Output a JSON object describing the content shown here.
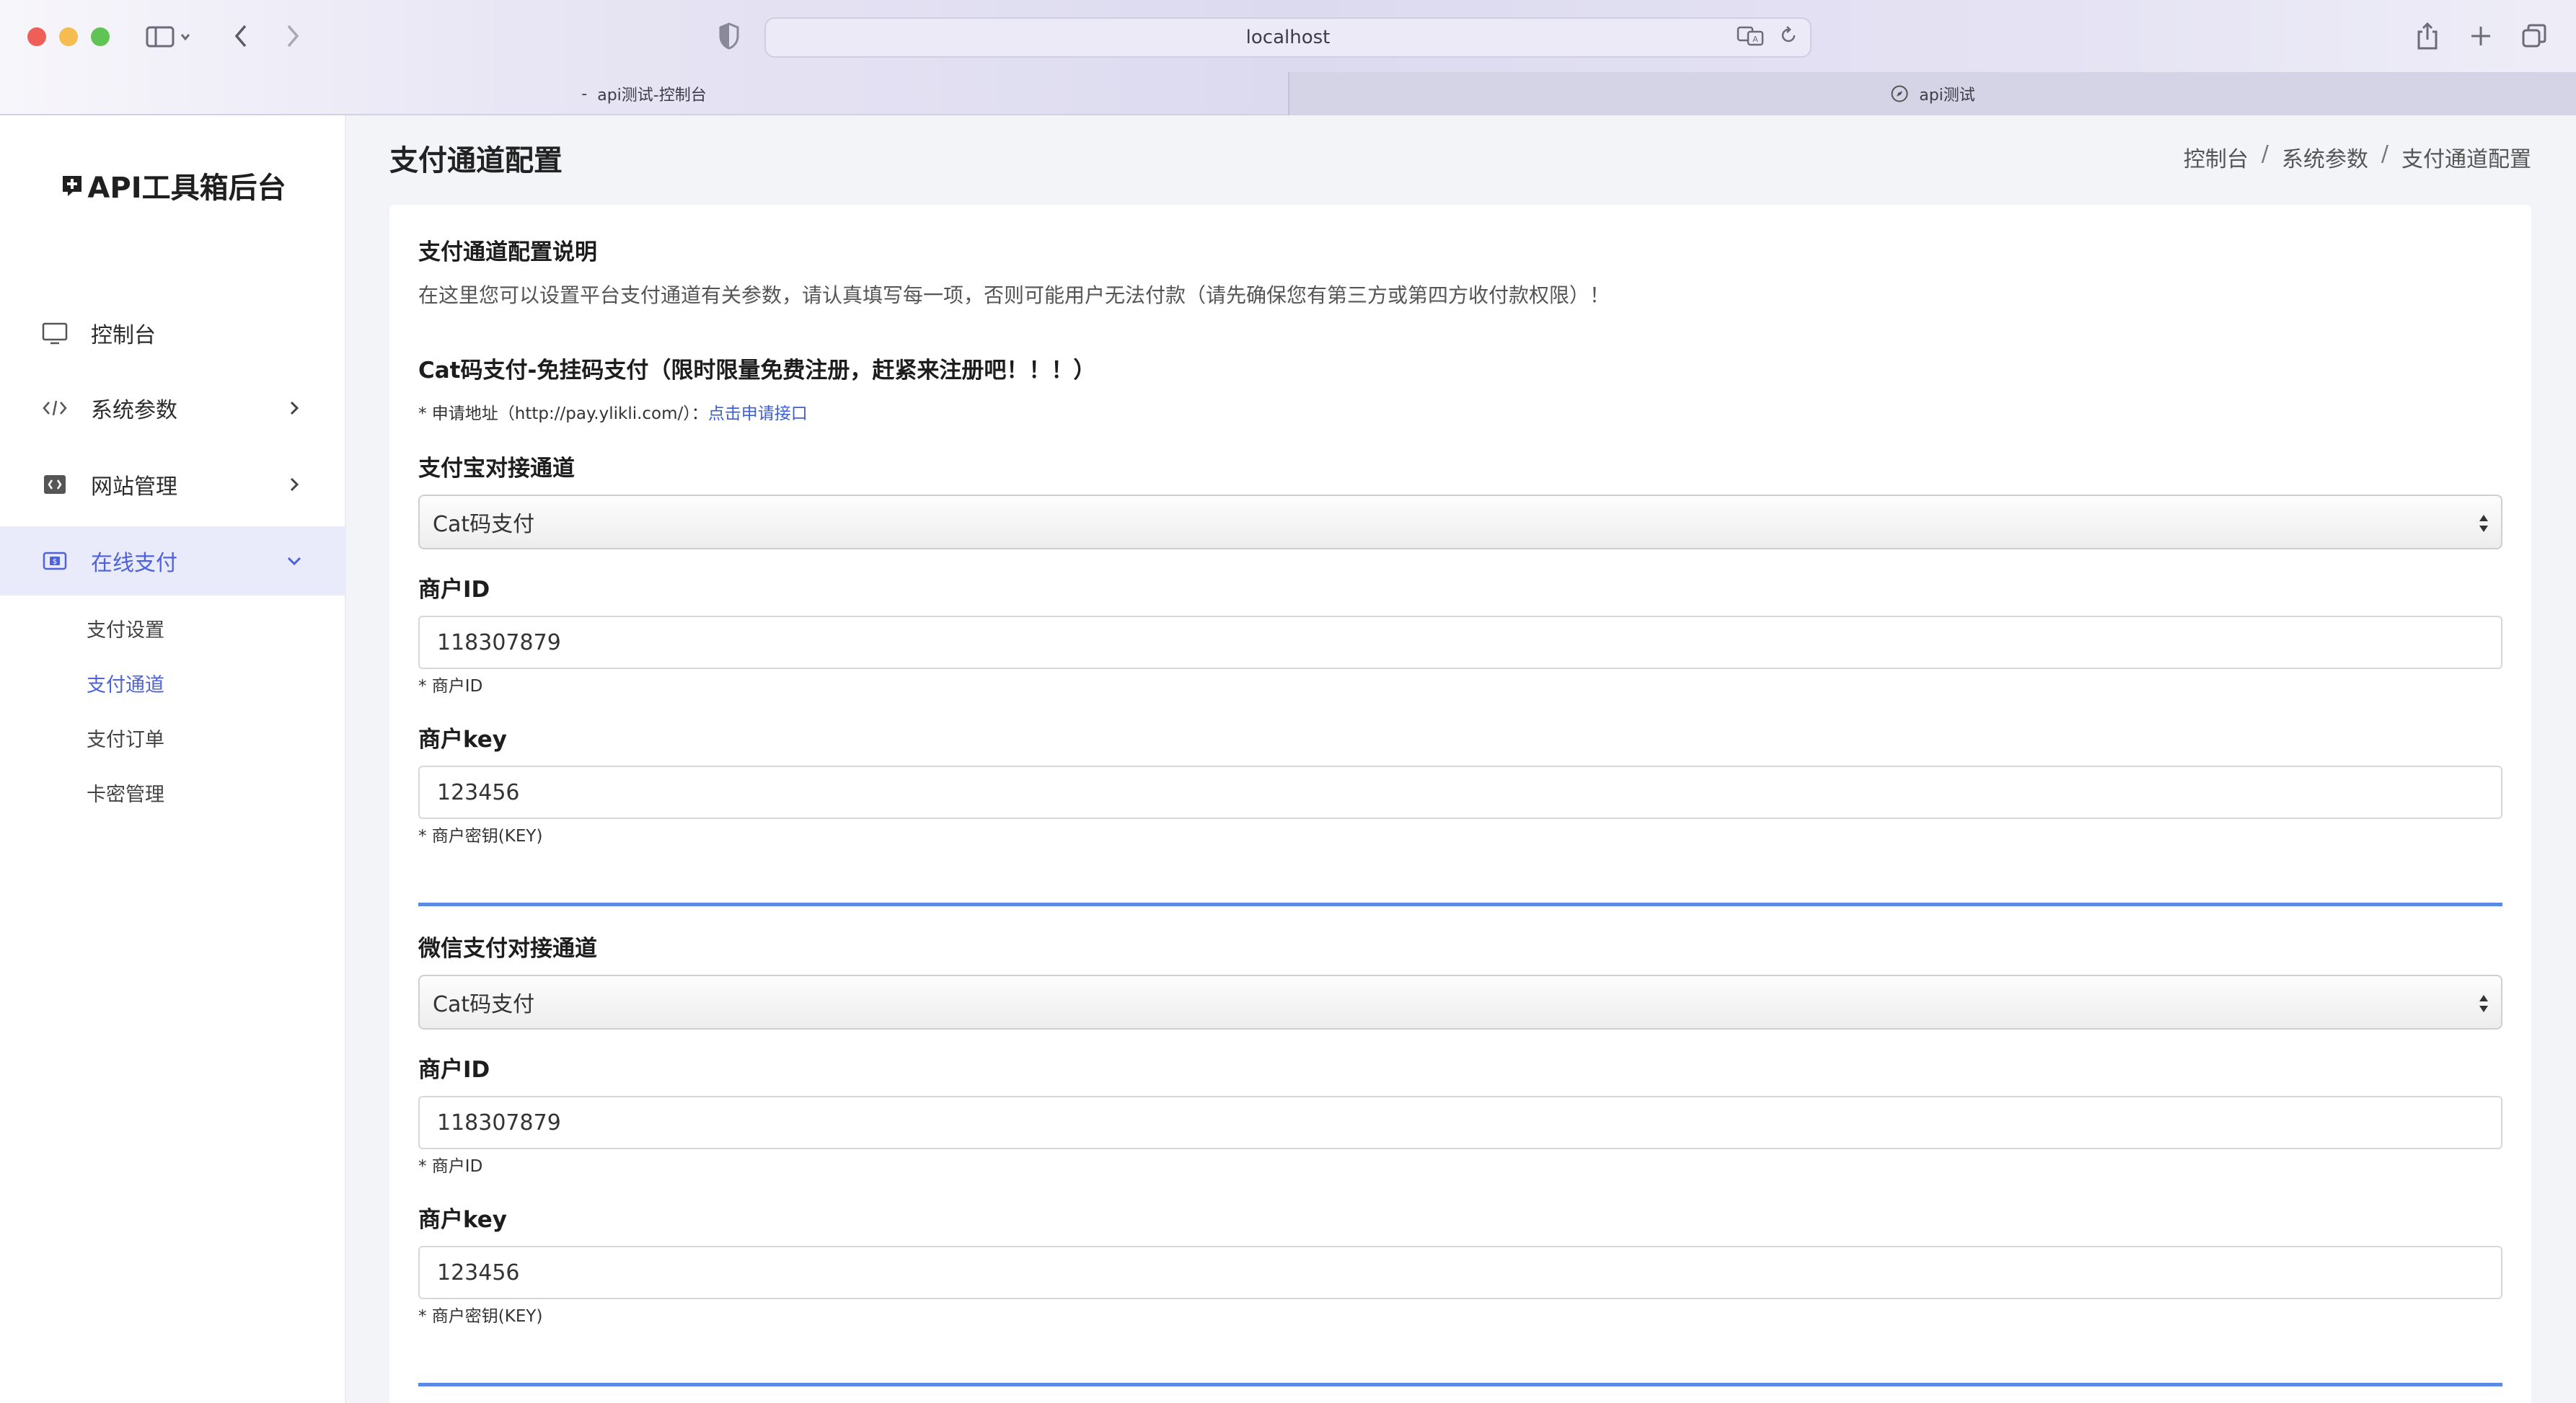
{
  "browser": {
    "url": "localhost",
    "tabs": [
      {
        "label": "api测试-控制台",
        "prefix": "-"
      },
      {
        "label": "api测试"
      }
    ]
  },
  "sidebar": {
    "brand": "API工具箱后台",
    "items": [
      {
        "label": "控制台",
        "icon": "monitor-icon"
      },
      {
        "label": "系统参数",
        "icon": "code-icon"
      },
      {
        "label": "网站管理",
        "icon": "image-icon"
      },
      {
        "label": "在线支付",
        "icon": "payment-icon"
      }
    ],
    "subitems": [
      {
        "label": "支付设置"
      },
      {
        "label": "支付通道"
      },
      {
        "label": "支付订单"
      },
      {
        "label": "卡密管理"
      }
    ]
  },
  "page": {
    "title": "支付通道配置",
    "breadcrumb": [
      "控制台",
      "系统参数",
      "支付通道配置"
    ]
  },
  "intro": {
    "title": "支付通道配置说明",
    "text": "在这里您可以设置平台支付通道有关参数，请认真填写每一项，否则可能用户无法付款（请先确保您有第三方或第四方收付款权限）！",
    "cat_title": "Cat码支付-免挂码支付（限时限量免费注册，赶紧来注册吧！！！）",
    "apply_prefix": "* 申请地址（http://pay.ylikli.com/）：",
    "apply_link": "点击申请接口"
  },
  "alipay": {
    "label": "支付宝对接通道",
    "channel": "Cat码支付",
    "merchant_id_label": "商户ID",
    "merchant_id": "118307879",
    "merchant_id_hint": "* 商户ID",
    "merchant_key_label": "商户key",
    "merchant_key": "123456",
    "merchant_key_hint": "* 商户密钥(KEY)"
  },
  "wechat": {
    "label": "微信支付对接通道",
    "channel": "Cat码支付",
    "merchant_id_label": "商户ID",
    "merchant_id": "118307879",
    "merchant_id_hint": "* 商户ID",
    "merchant_key_label": "商户key",
    "merchant_key": "123456",
    "merchant_key_hint": "* 商户密钥(KEY)"
  },
  "colors": {
    "accent": "#4e62d9",
    "divider": "#5b8ae6",
    "active_bg": "#e9ebfa"
  }
}
